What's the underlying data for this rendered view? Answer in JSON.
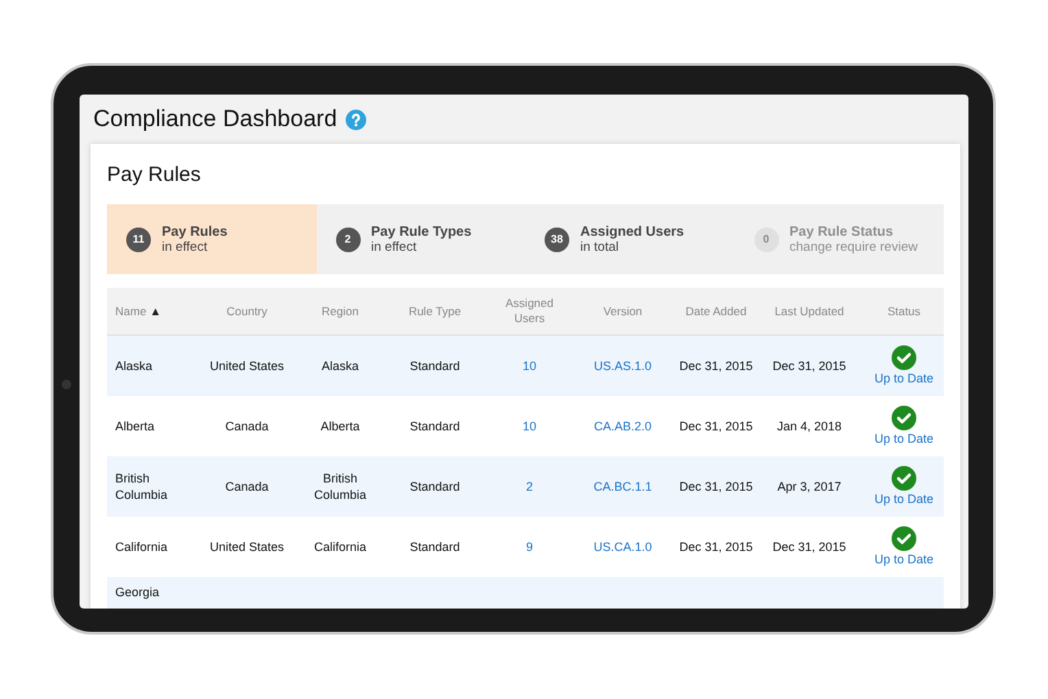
{
  "header": {
    "title": "Compliance Dashboard"
  },
  "section": {
    "title": "Pay Rules"
  },
  "summary": [
    {
      "count": "11",
      "label": "Pay Rules",
      "sublabel": "in effect",
      "selected": true,
      "disabled": false
    },
    {
      "count": "2",
      "label": "Pay Rule Types",
      "sublabel": "in effect",
      "selected": false,
      "disabled": false
    },
    {
      "count": "38",
      "label": "Assigned Users",
      "sublabel": "in total",
      "selected": false,
      "disabled": false
    },
    {
      "count": "0",
      "label": "Pay Rule Status",
      "sublabel": "change require review",
      "selected": false,
      "disabled": true
    }
  ],
  "table": {
    "columns": [
      {
        "label": "Name",
        "sort": "▲"
      },
      {
        "label": "Country"
      },
      {
        "label": "Region"
      },
      {
        "label": "Rule Type"
      },
      {
        "label": "Assigned Users"
      },
      {
        "label": "Version"
      },
      {
        "label": "Date Added"
      },
      {
        "label": "Last Updated"
      },
      {
        "label": "Status"
      }
    ],
    "rows": [
      {
        "name": "Alaska",
        "country": "United States",
        "region": "Alaska",
        "rule_type": "Standard",
        "users": "10",
        "version": "US.AS.1.0",
        "date_added": "Dec 31, 2015",
        "last_updated": "Dec 31, 2015",
        "status": "Up to Date"
      },
      {
        "name": "Alberta",
        "country": "Canada",
        "region": "Alberta",
        "rule_type": "Standard",
        "users": "10",
        "version": "CA.AB.2.0",
        "date_added": "Dec 31, 2015",
        "last_updated": "Jan 4, 2018",
        "status": "Up to Date"
      },
      {
        "name": "British Columbia",
        "country": "Canada",
        "region": "British Columbia",
        "rule_type": "Standard",
        "users": "2",
        "version": "CA.BC.1.1",
        "date_added": "Dec 31, 2015",
        "last_updated": "Apr 3, 2017",
        "status": "Up to Date"
      },
      {
        "name": "California",
        "country": "United States",
        "region": "California",
        "rule_type": "Standard",
        "users": "9",
        "version": "US.CA.1.0",
        "date_added": "Dec 31, 2015",
        "last_updated": "Dec 31, 2015",
        "status": "Up to Date"
      },
      {
        "name": "Georgia"
      }
    ]
  }
}
